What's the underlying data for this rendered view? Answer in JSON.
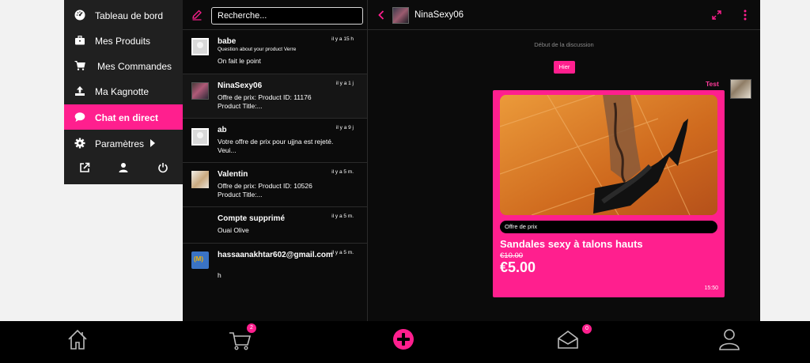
{
  "colors": {
    "accent": "#ff1f8e",
    "menu_bg": "#202020",
    "app_bg": "#0b0b0b"
  },
  "sidemenu": {
    "items": [
      {
        "label": "Tableau de bord",
        "icon": "dashboard-icon"
      },
      {
        "label": "Mes Produits",
        "icon": "briefcase-icon"
      },
      {
        "label": "Mes Commandes",
        "icon": "cart-icon"
      },
      {
        "label": "Ma Kagnotte",
        "icon": "upload-icon"
      },
      {
        "label": "Chat en direct",
        "icon": "chat-bubble-icon",
        "active": true
      },
      {
        "label": "Paramètres",
        "icon": "gear-icon"
      }
    ],
    "bottom_icons": [
      "external-link-icon",
      "user-icon",
      "power-icon"
    ]
  },
  "convlist": {
    "search_placeholder": "Recherche...",
    "conversations": [
      {
        "name": "babe",
        "time": "il y a 15 h",
        "sub": "Question about your product Verre",
        "preview": "On fait le point"
      },
      {
        "name": "NinaSexy06",
        "time": "il y a 1 j",
        "preview": "Offre de prix: Product ID: 11176 Product Title:..."
      },
      {
        "name": "ab",
        "time": "il y a 9 j",
        "preview": "Votre offre de prix pour ujjna est rejeté. Veui..."
      },
      {
        "name": "Valentin",
        "time": "il y a 5 m.",
        "preview": "Offre de prix: Product ID: 10526 Product Title:..."
      },
      {
        "name": "Compte supprimé",
        "time": "il y a 5 m.",
        "preview": "Ouai Olive"
      },
      {
        "name": "hassaanakhtar602@gmail.com",
        "time": "il y a 5 m.",
        "preview": "h"
      }
    ]
  },
  "thread": {
    "title": "NinaSexy06",
    "start_label": "Début de la discussion",
    "day_chip": "Hier",
    "sender": "Test",
    "offer": {
      "tag": "Offre de prix",
      "title": "Sandales sexy à talons hauts",
      "old_price": "€10.00",
      "new_price": "€5.00",
      "time": "15:50"
    }
  },
  "bottomnav": {
    "items": [
      {
        "icon": "home-icon"
      },
      {
        "icon": "cart-icon",
        "badge": "2"
      },
      {
        "icon": "plus-circle-icon"
      },
      {
        "icon": "mail-icon",
        "badge": "0"
      },
      {
        "icon": "user-icon"
      }
    ]
  }
}
